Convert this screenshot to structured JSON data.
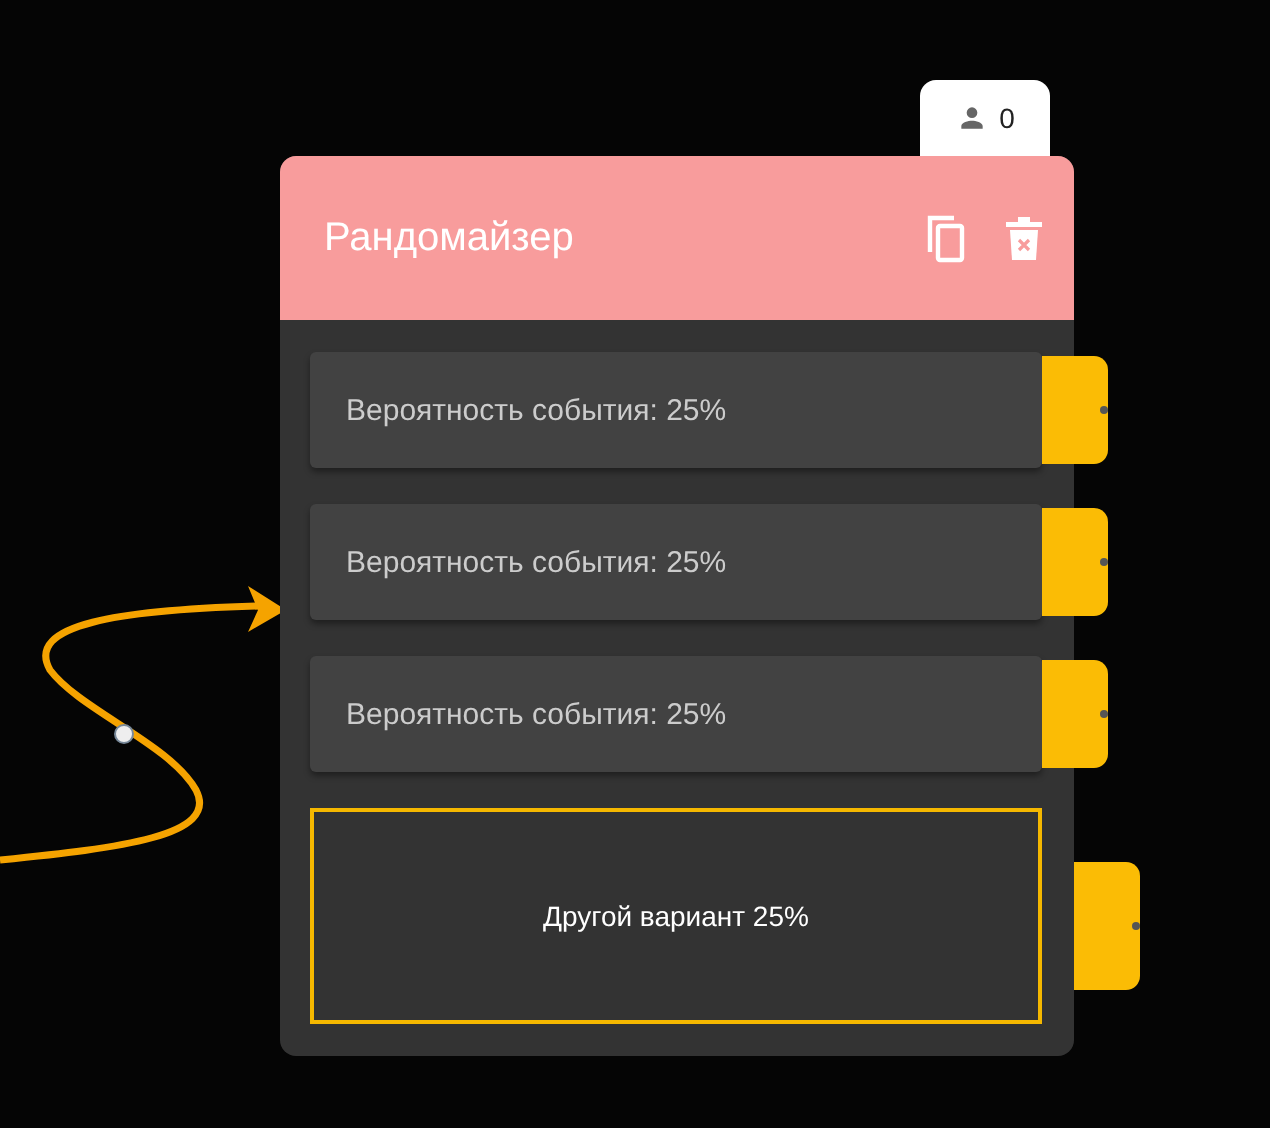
{
  "badge": {
    "count": "0"
  },
  "node": {
    "title": "Рандомайзер",
    "options": [
      {
        "kind": "option",
        "text": "Вероятность события: 25%"
      },
      {
        "kind": "option",
        "text": "Вероятность события: 25%"
      },
      {
        "kind": "option",
        "text": "Вероятность события: 25%"
      },
      {
        "kind": "default",
        "text": "Другой вариант 25%"
      }
    ]
  }
}
